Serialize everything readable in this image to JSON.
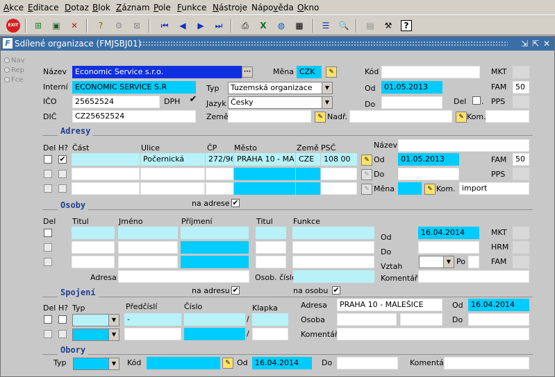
{
  "menu": [
    "Akce",
    "Editace",
    "Dotaz",
    "Blok",
    "Záznam",
    "Pole",
    "Funkce",
    "Nástroje",
    "Nápověda",
    "Okno"
  ],
  "menu_underline": [
    "A",
    "E",
    "D",
    "B",
    "Z",
    "P",
    "F",
    "N",
    "v",
    "O"
  ],
  "toolbar": {
    "exit_label": "EXIT"
  },
  "window": {
    "title": "Sdílené organizace (FMJSBJ01)"
  },
  "side_nav": [
    "Nav",
    "Rep",
    "Fce"
  ],
  "org": {
    "nazev_label": "Název",
    "nazev_value": "Economic Service s.r.o.",
    "interni_label": "Interní",
    "interni_value": "ECONOMIC SERVICE S.R",
    "ico_label": "IČO",
    "ico_value": "25652524",
    "dph_label": "DPH",
    "dic_label": "DIČ",
    "dic_value": "CZ25652524",
    "mena_label": "Měna",
    "mena_value": "CZK",
    "typ_label": "Typ",
    "typ_value": "Tuzemská organizace",
    "jazyk_label": "Jazyk",
    "jazyk_value": "Česky",
    "zeme_label": "Země",
    "nadr_label": "Nadř.",
    "kod_label": "Kód",
    "od_label": "Od",
    "od_value": "01.05.2013",
    "do_label": "Do",
    "del_label": "Del",
    "dot": ".",
    "kom_label": "Kom.",
    "mkt_label": "MKT",
    "fam_label": "FAM",
    "fam_value": "50",
    "pps_label": "PPS"
  },
  "adresy": {
    "title": "Adresy",
    "headers": {
      "del": "Del",
      "h": "H?",
      "cast": "Část",
      "ulice": "Ulice",
      "cp": "ČP",
      "mesto": "Město",
      "zeme": "Země",
      "psc": "PSČ"
    },
    "row1": {
      "ulice": "Počernická",
      "cp": "272/96",
      "mesto": "PRAHA 10 - MALEŠICE",
      "zeme": "CZE",
      "psc": "108 00"
    },
    "nazev_label": "Název",
    "od_label": "Od",
    "od_value": "01.05.2013",
    "do_label": "Do",
    "mena_label": "Měna",
    "kom_label": "Kom.",
    "kom_value": "import",
    "fam_label": "FAM",
    "fam_value": "50",
    "pps_label": "PPS"
  },
  "osoby": {
    "title": "Osoby",
    "na_adrese": "na adrese",
    "headers": {
      "del": "Del",
      "titul": "Titul",
      "jmeno": "Jméno",
      "prijmeni": "Příjmení",
      "titul2": "Titul",
      "funkce": "Funkce"
    },
    "od_label": "Od",
    "od_value": "16.04.2014",
    "do_label": "Do",
    "vztah_label": "Vztah",
    "po_label": "Po",
    "mkt_label": "MKT",
    "hrm_label": "HRM",
    "fam_label": "FAM",
    "adresa_label": "Adresa",
    "osob_cislo_label": "Osob. číslo",
    "komentar_label": "Komentář"
  },
  "spojeni": {
    "title": "Spojení",
    "na_adresu": "na adresu",
    "na_osobu": "na osobu",
    "headers": {
      "del": "Del",
      "h": "H?",
      "typ": "Typ",
      "predcisli": "Předčíslí",
      "cislo": "Číslo",
      "klapka": "Klapka"
    },
    "row1_predcisli": "-",
    "slash": "/",
    "adresa_label": "Adresa",
    "adresa_value": "PRAHA 10 - MALEŠICE",
    "od_label": "Od",
    "od_value": "16.04.2014",
    "osoba_label": "Osoba",
    "do_label": "Do",
    "komentar_label": "Komentář"
  },
  "obory": {
    "title": "Obory",
    "typ_label": "Typ",
    "kod_label": "Kód",
    "od_label": "Od",
    "od_value": "16.04.2014",
    "do_label": "Do",
    "komentar_label": "Komentář"
  }
}
